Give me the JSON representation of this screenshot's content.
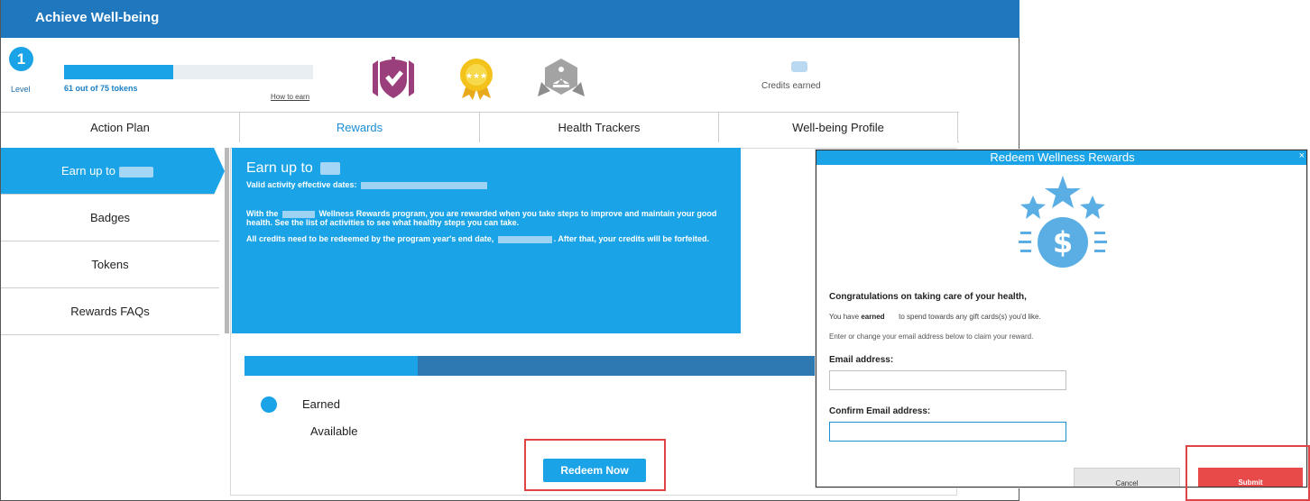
{
  "app": {
    "title": "Achieve Well-being"
  },
  "status": {
    "level_number": "1",
    "level_label": "Level",
    "tokens_text": "61 out of 75 tokens",
    "tokens_progress": 0.44,
    "how_to_earn": "How to earn",
    "credits_label": "Credits earned",
    "badges": [
      "shield-check-badge-icon",
      "three-star-medal-icon",
      "meditation-badge-icon"
    ],
    "colors": {
      "accent": "#1aa3e6",
      "header": "#1f78bd",
      "badge_purple": "#9b3f7c",
      "badge_gold": "#f3c21b",
      "badge_gray": "#9a9a9a"
    }
  },
  "tabs": [
    {
      "label": "Action Plan"
    },
    {
      "label": "Rewards"
    },
    {
      "label": "Health Trackers"
    },
    {
      "label": "Well-being Profile"
    }
  ],
  "sidebar": {
    "items": [
      {
        "label": "Earn up to"
      },
      {
        "label": "Badges"
      },
      {
        "label": "Tokens"
      },
      {
        "label": "Rewards FAQs"
      }
    ]
  },
  "info": {
    "title": "Earn up to",
    "valid_label": "Valid activity effective dates:",
    "para1_a": "With the",
    "para1_b": "Wellness Rewards program, you are rewarded when you take steps to improve and maintain your good health.  See the list of activities to see what healthy steps you can take.",
    "para2_a": "All credits need to be redeemed by the program year's end date,",
    "para2_b": ". After that, your credits will be forfeited."
  },
  "credits_progress": {
    "earned_fraction": 0.3,
    "legend_earned": "Earned",
    "legend_available": "Available",
    "redeem_label": "Redeem Now"
  },
  "modal": {
    "title": "Redeem Wellness Rewards",
    "close": "×",
    "congrats": "Congratulations on taking care of your health,",
    "you_have_a": "You have",
    "you_have_b": "earned",
    "you_have_c": "to spend towards any gift cards(s) you'd like.",
    "enter_text": "Enter or change your email address below to claim your reward.",
    "email_label": "Email address:",
    "confirm_label": "Confirm Email address:",
    "cancel_label": "Cancel",
    "submit_label": "Submit"
  }
}
